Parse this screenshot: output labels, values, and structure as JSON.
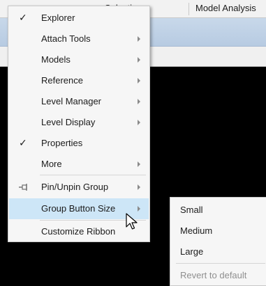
{
  "app": {
    "tab_partial": "Selection",
    "tab_model_analysis": "Model Analysis"
  },
  "menu": {
    "items": [
      {
        "label": "Explorer",
        "checked": true,
        "submenu": false,
        "icon": "check-icon"
      },
      {
        "label": "Attach Tools",
        "checked": false,
        "submenu": true
      },
      {
        "label": "Models",
        "checked": false,
        "submenu": true
      },
      {
        "label": "Reference",
        "checked": false,
        "submenu": true
      },
      {
        "label": "Level Manager",
        "checked": false,
        "submenu": true
      },
      {
        "label": "Level Display",
        "checked": false,
        "submenu": true
      },
      {
        "label": "Properties",
        "checked": true,
        "submenu": false,
        "icon": "check-icon"
      },
      {
        "label": "More",
        "checked": false,
        "submenu": true
      },
      {
        "label": "Pin/Unpin Group",
        "checked": false,
        "submenu": true,
        "icon": "pin-icon"
      },
      {
        "label": "Group Button Size",
        "checked": false,
        "submenu": true,
        "highlighted": true
      },
      {
        "label": "Customize Ribbon",
        "checked": false,
        "submenu": false
      }
    ],
    "check_glyph": "✓"
  },
  "submenu": {
    "items": [
      {
        "label": "Small",
        "disabled": false
      },
      {
        "label": "Medium",
        "disabled": false
      },
      {
        "label": "Large",
        "disabled": false
      },
      {
        "label": "Revert to default",
        "disabled": true
      }
    ]
  },
  "colors": {
    "highlight": "#cde6f7",
    "menu_bg": "#f6f6f6",
    "ribbon": "#b7cbe2"
  }
}
